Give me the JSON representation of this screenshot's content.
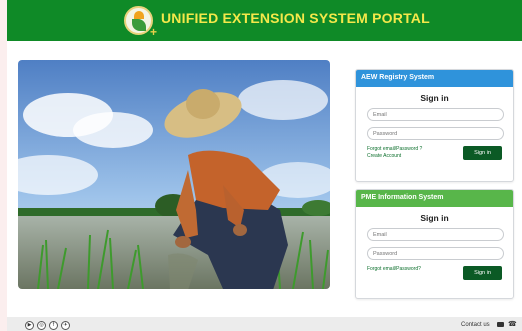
{
  "header": {
    "title": "UNIFIED EXTENSION SYSTEM PORTAL",
    "logo_icon": "ues-logo-icon"
  },
  "hero": {
    "icon": "farmer-planting-rice-image"
  },
  "aew_card": {
    "title": "AEW Registry System",
    "heading": "Sign in",
    "email_placeholder": "Email",
    "password_placeholder": "Password",
    "forgot_label": "Forgot email/Password ?",
    "create_label": "Create Account",
    "signin_button": "Sign in",
    "header_color": "#2f93db"
  },
  "pme_card": {
    "title": "PME Information System",
    "heading": "Sign in",
    "email_placeholder": "Email",
    "password_placeholder": "Password",
    "forgot_label": "Forgot email/Password?",
    "signin_button": "Sign in",
    "header_color": "#58b64a"
  },
  "footer": {
    "social_icons": [
      "youtube-icon",
      "instagram-icon",
      "facebook-icon",
      "telegram-icon"
    ],
    "social_glyphs": [
      "▶",
      "◎",
      "f",
      "✈"
    ],
    "contact_label": "Contact us"
  },
  "colors": {
    "brand_green": "#0f8a27",
    "title_yellow": "#f4e84a",
    "button_green": "#0b5a25"
  }
}
